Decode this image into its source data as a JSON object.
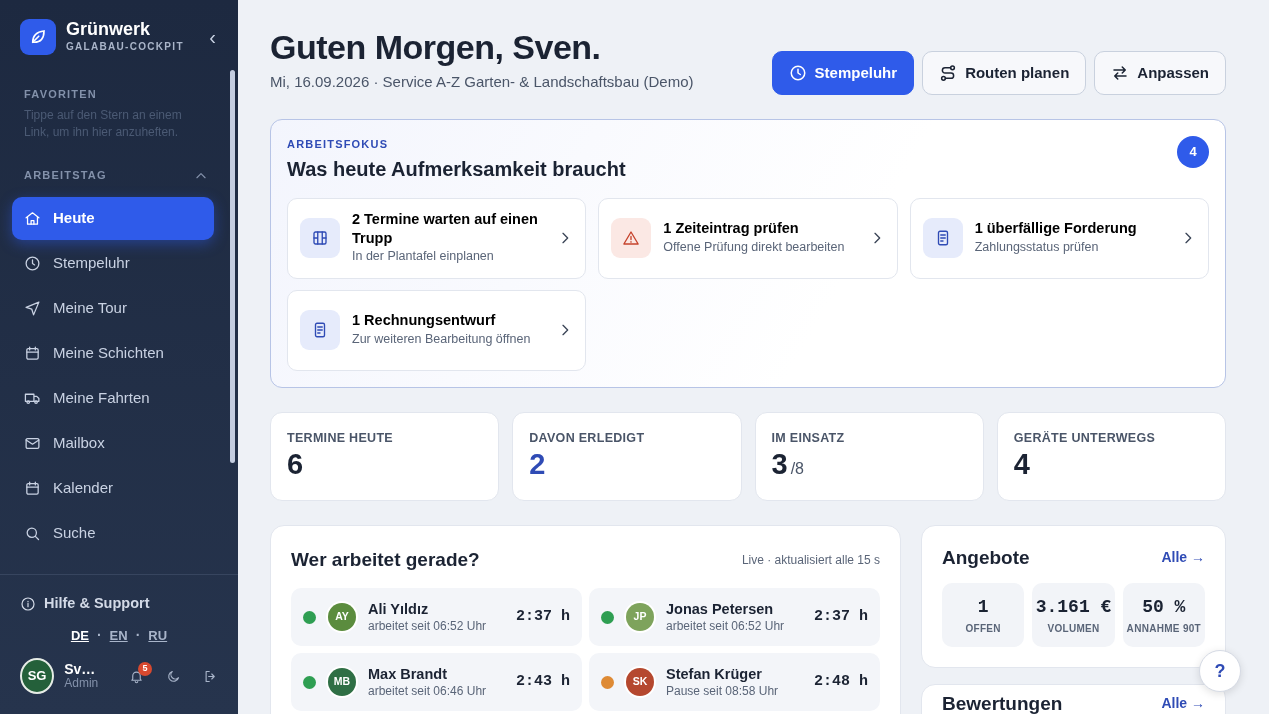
{
  "brand": {
    "name": "Grünwerk",
    "subtitle": "GALABAU-COCKPIT",
    "collapse": "‹"
  },
  "sidebar": {
    "favorites": {
      "title": "FAVORITEN",
      "hint": "Tippe auf den Stern an einem Link, um ihn hier anzuheften."
    },
    "section": {
      "title": "ARBEITSTAG",
      "expanded": true
    },
    "items": [
      {
        "label": "Heute",
        "selected": true
      },
      {
        "label": "Stempeluhr",
        "selected": false
      },
      {
        "label": "Meine Tour",
        "selected": false
      },
      {
        "label": "Meine Schichten",
        "selected": false
      },
      {
        "label": "Meine Fahrten",
        "selected": false
      },
      {
        "label": "Mailbox",
        "selected": false
      },
      {
        "label": "Kalender",
        "selected": false
      },
      {
        "label": "Suche",
        "selected": false
      }
    ],
    "help": "Hilfe & Support",
    "languages": [
      {
        "label": "DE",
        "selected": true
      },
      {
        "label": "EN",
        "selected": false
      },
      {
        "label": "RU",
        "selected": false
      }
    ],
    "language_separator": "·",
    "user": {
      "initials": "SG",
      "name": "Sv…",
      "role": "Admin",
      "notifications": "5"
    }
  },
  "header": {
    "title": "Guten Morgen, Sven.",
    "subtitle": "Mi, 16.09.2026 · Service A-Z Garten- & Landschaftsbau (Demo)",
    "buttons": [
      {
        "label": "Stempeluhr",
        "kind": "primary"
      },
      {
        "label": "Routen planen",
        "kind": "outline"
      },
      {
        "label": "Anpassen",
        "kind": "outline"
      }
    ]
  },
  "focus": {
    "eyebrow": "ARBEITSFOKUS",
    "title": "Was heute Aufmerksamkeit braucht",
    "count": "4",
    "items": [
      {
        "title": "2 Termine warten auf einen Trupp",
        "subtitle": "In der Plantafel einplanen",
        "kind": "info"
      },
      {
        "title": "1 Zeiteintrag prüfen",
        "subtitle": "Offene Prüfung direkt bearbeiten",
        "kind": "warning"
      },
      {
        "title": "1 überfällige Forderung",
        "subtitle": "Zahlungsstatus prüfen",
        "kind": "info"
      },
      {
        "title": "1 Rechnungsentwurf",
        "subtitle": "Zur weiteren Bearbeitung öffnen",
        "kind": "info"
      }
    ]
  },
  "stats": [
    {
      "label": "TERMINE HEUTE",
      "value": "6",
      "accent": false
    },
    {
      "label": "DAVON ERLEDIGT",
      "value": "2",
      "accent": true
    },
    {
      "label": "IM EINSATZ",
      "value": "3",
      "suffix": "/8",
      "accent": false
    },
    {
      "label": "GERÄTE UNTERWEGS",
      "value": "4",
      "accent": false
    }
  ],
  "team": {
    "title": "Wer arbeitet gerade?",
    "note": "Live · aktualisiert alle 15 s",
    "people": [
      {
        "initials": "AY",
        "name": "Ali Yıldız",
        "status": "arbeitet seit 06:52 Uhr",
        "time": "2:37 h",
        "color": "#2e9e52"
      },
      {
        "initials": "JP",
        "name": "Jonas Petersen",
        "status": "arbeitet seit 06:52 Uhr",
        "time": "2:37 h",
        "color": "#2e9e52"
      },
      {
        "initials": "MB",
        "name": "Max Brandt",
        "status": "arbeitet seit 06:46 Uhr",
        "time": "2:43 h",
        "color": "#2e9e52"
      },
      {
        "initials": "SK",
        "name": "Stefan Krüger",
        "status": "Pause seit 08:58 Uhr",
        "time": "2:48 h",
        "color": "#de8a35"
      }
    ]
  },
  "offers": {
    "title": "Angebote",
    "link": "Alle →",
    "metrics": [
      {
        "value": "1",
        "label": "OFFEN"
      },
      {
        "value": "3.161 €",
        "label": "VOLUMEN"
      },
      {
        "value": "50 %",
        "label": "ANNAHME 90T"
      }
    ]
  },
  "reviews": {
    "title": "Bewertungen",
    "link": "Alle →"
  },
  "help_button": "?"
}
